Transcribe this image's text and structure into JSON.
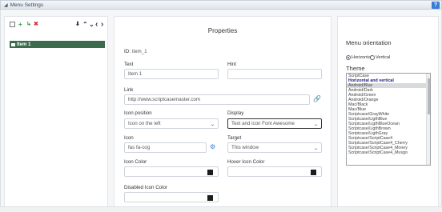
{
  "window": {
    "title": "Menu Settings",
    "help_label": "?"
  },
  "toolbar": {
    "add_icon": "+",
    "indent_icon": "↳",
    "delete_icon": "✖",
    "import_icon": "⬇",
    "up_icon": "⌃",
    "down_icon": "⌄",
    "left_icon": "‹",
    "right_icon": "›"
  },
  "tree": {
    "items": [
      {
        "label": "Item 1"
      }
    ]
  },
  "properties": {
    "title": "Properties",
    "id_label": "ID:",
    "id_value": "item_1",
    "text": {
      "label": "Text",
      "value": "Item 1"
    },
    "hint": {
      "label": "Hint",
      "value": ""
    },
    "link": {
      "label": "Link",
      "value": "http://www.scriptcasemaster.com"
    },
    "icon_position": {
      "label": "Icon position",
      "value": "Icon on the left"
    },
    "display": {
      "label": "Display",
      "value": "Text and icon Font Awesome"
    },
    "icon": {
      "label": "Icon",
      "value": "fas fa-cog"
    },
    "target": {
      "label": "Target",
      "value": "This window"
    },
    "icon_color": {
      "label": "Icon Color",
      "value": "#1c1c1c"
    },
    "hover_icon_color": {
      "label": "Hover Icon Color",
      "value": "#1c1c1c"
    },
    "disabled_icon_color": {
      "label": "Disabled Icon Color",
      "value": "#1c1c1c"
    }
  },
  "orientation": {
    "title": "Menu orientation",
    "options": [
      {
        "label": "Horizontal",
        "checked": true
      },
      {
        "label": "Vertical",
        "checked": false
      }
    ]
  },
  "theme": {
    "title": "Theme",
    "options": [
      {
        "label": "ScriptCase",
        "type": "option"
      },
      {
        "label": "Horizontal and vertical",
        "type": "group"
      },
      {
        "label": "Android/Blue",
        "type": "selected"
      },
      {
        "label": "Android/Dark",
        "type": "option"
      },
      {
        "label": "Android/Green",
        "type": "option"
      },
      {
        "label": "Android/Orange",
        "type": "option"
      },
      {
        "label": "Mac/Black",
        "type": "option"
      },
      {
        "label": "Mac/Blue",
        "type": "option"
      },
      {
        "label": "Scriptcase/GrayWhite",
        "type": "option"
      },
      {
        "label": "Scriptcase/LigthBlue",
        "type": "option"
      },
      {
        "label": "Scriptcase/LigthBlueOcean",
        "type": "option"
      },
      {
        "label": "Scriptcase/LigthBrown",
        "type": "option"
      },
      {
        "label": "Scriptcase/LigthGray",
        "type": "option"
      },
      {
        "label": "Scriptcase/ScriptCase4",
        "type": "option"
      },
      {
        "label": "Scriptcase/ScriptCase4_Cherry",
        "type": "option"
      },
      {
        "label": "Scriptcase/ScriptCase4_Money",
        "type": "option"
      },
      {
        "label": "Scriptcase/ScriptCase4_Musgo",
        "type": "option"
      }
    ]
  },
  "colors": {
    "tree_selected": "#3d6b4e",
    "help_button": "#3a7bd5",
    "swatch": "#1c1c1c"
  }
}
